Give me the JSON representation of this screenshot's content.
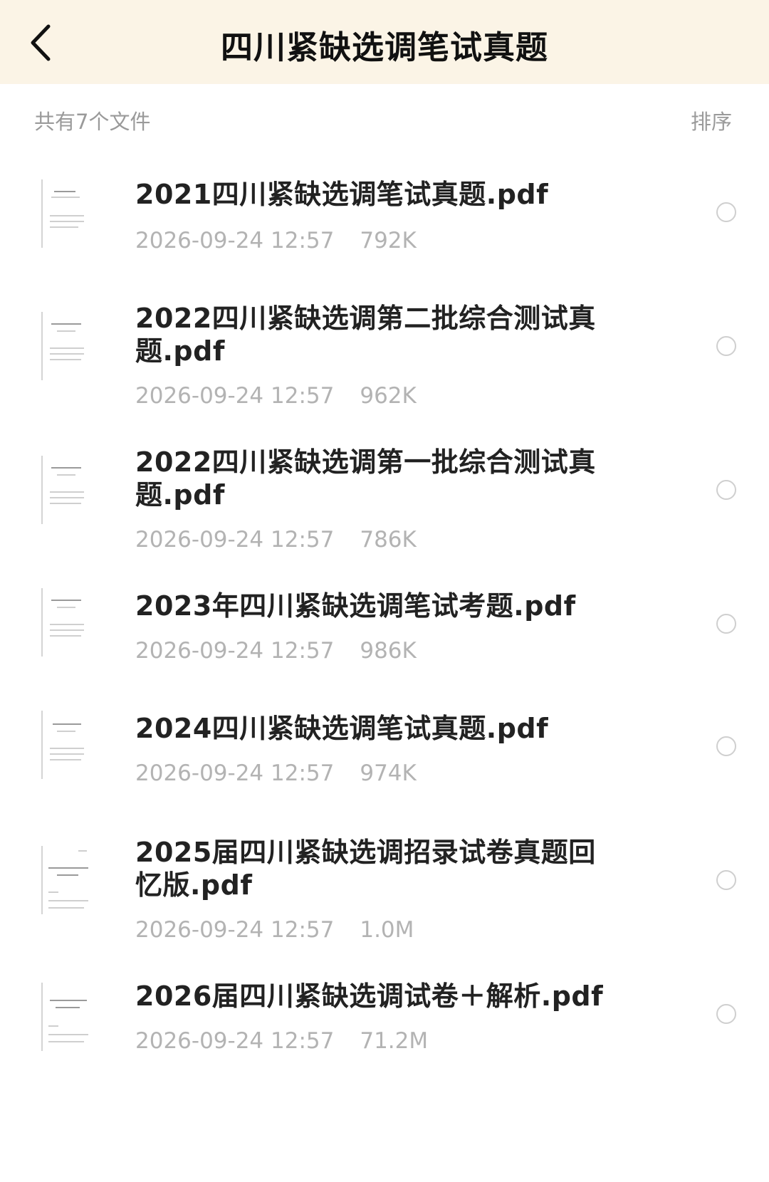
{
  "header": {
    "title": "四川紧缺选调笔试真题",
    "back_icon": "chevron-left-icon"
  },
  "summary": {
    "file_count": "共有7个文件",
    "sort_label": "排序"
  },
  "files": [
    {
      "name": "2021四川紧缺选调笔试真题.pdf",
      "date": "2026-09-24 12:57",
      "size": "792K"
    },
    {
      "name": "2022四川紧缺选调第二批综合测试真题.pdf",
      "date": "2026-09-24 12:57",
      "size": "962K"
    },
    {
      "name": "2022四川紧缺选调第一批综合测试真题.pdf",
      "date": "2026-09-24 12:57",
      "size": "786K"
    },
    {
      "name": "2023年四川紧缺选调笔试考题.pdf",
      "date": "2026-09-24 12:57",
      "size": "986K"
    },
    {
      "name": "2024四川紧缺选调笔试真题.pdf",
      "date": "2026-09-24 12:57",
      "size": "974K"
    },
    {
      "name": "2025届四川紧缺选调招录试卷真题回忆版.pdf",
      "date": "2026-09-24 12:57",
      "size": "1.0M"
    },
    {
      "name": "2026届四川紧缺选调试卷＋解析.pdf",
      "date": "2026-09-24 12:57",
      "size": "71.2M"
    }
  ]
}
